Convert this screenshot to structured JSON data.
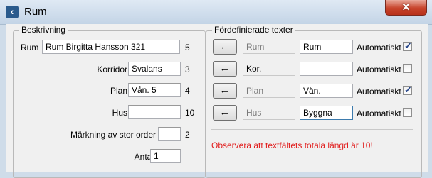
{
  "window": {
    "title": "Rum",
    "close_label": "✕"
  },
  "description_group": {
    "title": "Beskrivning",
    "rows": [
      {
        "label": "Rum",
        "value": "Rum Birgitta Hansson 321",
        "max": "5"
      },
      {
        "label": "Korridor",
        "value": "Svalans",
        "max": "3"
      },
      {
        "label": "Plan",
        "value": "Vån. 5",
        "max": "4"
      },
      {
        "label": "Hus",
        "value": "",
        "max": "10"
      },
      {
        "label": "Märkning av stor order",
        "value": "",
        "max": "2"
      },
      {
        "label": "Antal",
        "value": "1",
        "max": ""
      }
    ]
  },
  "predefined_group": {
    "title": "Fördefinierade texter",
    "arrow_label": "←",
    "auto_label": "Automatiskt",
    "rows": [
      {
        "source": "Rum",
        "value": "Rum",
        "auto": true
      },
      {
        "source": "Kor.",
        "value": "",
        "auto": false
      },
      {
        "source": "Plan",
        "value": "Vån.",
        "auto": true
      },
      {
        "source": "Hus",
        "value": "Byggna",
        "auto": false
      }
    ],
    "warning": "Observera att textfältets totala längd är 10!"
  },
  "check_mark": "✓"
}
